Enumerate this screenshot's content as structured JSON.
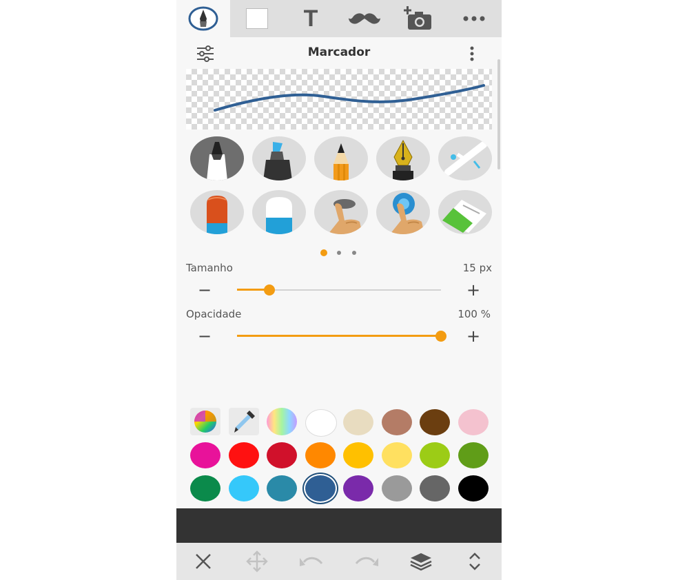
{
  "toolbar": {
    "tools": [
      "brush-tool",
      "color-tool",
      "text-tool",
      "sticker-tool",
      "add-photo-tool",
      "more-tool"
    ],
    "text_glyph": "T",
    "active": "brush-tool"
  },
  "panel": {
    "title": "Marcador"
  },
  "stroke_preview": {
    "stroke_color": "#2f5f94"
  },
  "brushes": {
    "row1": [
      "marker",
      "highlighter",
      "pencil",
      "fountain-pen",
      "airbrush"
    ],
    "row2": [
      "eraser-hard",
      "eraser-soft",
      "smudge",
      "blur",
      "eraser-block"
    ]
  },
  "pager": {
    "pages": 3,
    "current": 1,
    "accent": "#f39c12"
  },
  "size": {
    "label": "Tamanho",
    "value": "15 px",
    "fraction": 0.16,
    "minus": "−",
    "plus": "+"
  },
  "opacity": {
    "label": "Opacidade",
    "value": "100 %",
    "fraction": 1.0,
    "minus": "−",
    "plus": "+"
  },
  "palette": {
    "tools": [
      "color-wheel",
      "eyedropper",
      "rainbow"
    ],
    "colors": [
      "#ffffff",
      "#e8dcc0",
      "#b47c66",
      "#6b3e10",
      "#f4c2cf",
      "#e8129a",
      "#ff1111",
      "#d0112b",
      "#ff8800",
      "#ffc000",
      "#ffe060",
      "#9ccc16",
      "#609d18",
      "#0b8a4b",
      "#35c8fa",
      "#2a8aa8",
      "#2f5f94",
      "#7a2aaa",
      "#9a9a9a",
      "#666666",
      "#000000"
    ],
    "selected_index": 16
  },
  "bottom_bar": {
    "buttons": [
      "close",
      "move",
      "undo",
      "redo",
      "layers",
      "expand"
    ]
  }
}
